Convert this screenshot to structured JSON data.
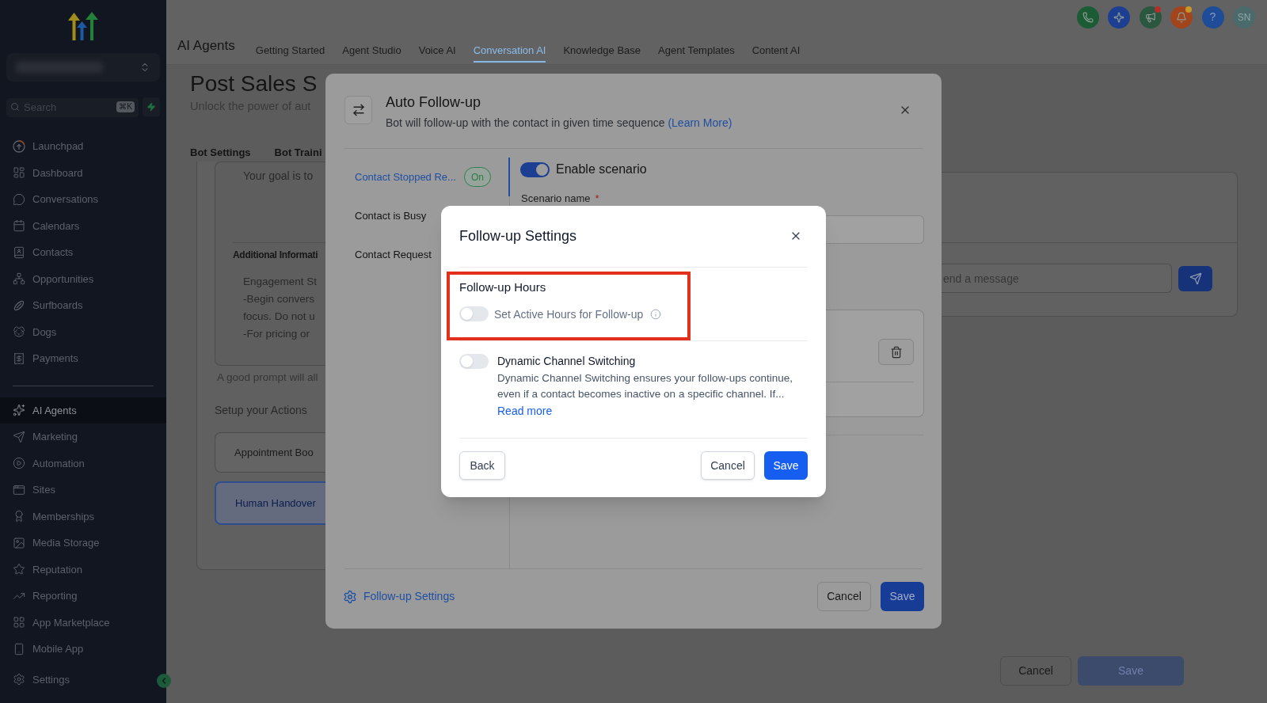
{
  "sidebar": {
    "search": {
      "placeholder": "Search",
      "shortcut": "⌘K"
    },
    "groups": [
      {
        "items": [
          {
            "label": "Launchpad",
            "selected": false
          },
          {
            "label": "Dashboard",
            "selected": false
          },
          {
            "label": "Conversations",
            "selected": false
          },
          {
            "label": "Calendars",
            "selected": false
          },
          {
            "label": "Contacts",
            "selected": false
          },
          {
            "label": "Opportunities",
            "selected": false
          },
          {
            "label": "Surfboards",
            "selected": false
          },
          {
            "label": "Dogs",
            "selected": false
          },
          {
            "label": "Payments",
            "selected": false
          }
        ]
      },
      {
        "items": [
          {
            "label": "AI Agents",
            "selected": true
          },
          {
            "label": "Marketing",
            "selected": false
          },
          {
            "label": "Automation",
            "selected": false
          },
          {
            "label": "Sites",
            "selected": false
          },
          {
            "label": "Memberships",
            "selected": false
          },
          {
            "label": "Media Storage",
            "selected": false
          },
          {
            "label": "Reputation",
            "selected": false
          },
          {
            "label": "Reporting",
            "selected": false
          },
          {
            "label": "App Marketplace",
            "selected": false
          },
          {
            "label": "Mobile App",
            "selected": false
          }
        ]
      }
    ],
    "settings": {
      "label": "Settings",
      "selected": false
    }
  },
  "header": {
    "title": "AI Agents",
    "tabs": [
      {
        "label": "Getting Started",
        "selected": false
      },
      {
        "label": "Agent Studio",
        "selected": false
      },
      {
        "label": "Voice AI",
        "selected": false
      },
      {
        "label": "Conversation AI",
        "selected": true
      },
      {
        "label": "Knowledge Base",
        "selected": false
      },
      {
        "label": "Agent Templates",
        "selected": false
      },
      {
        "label": "Content AI",
        "selected": false
      }
    ],
    "help_label": "?",
    "avatar_initials": "SN"
  },
  "page": {
    "title": "Post Sales S",
    "subtitle": "Unlock the power of aut",
    "tabs": [
      {
        "label": "Bot Settings"
      },
      {
        "label": "Bot Traini"
      }
    ],
    "prompt": {
      "intro": "Your goal is to",
      "section_title": "Additional Informati",
      "lines": [
        "Engagement St",
        "-Begin convers",
        "focus. Do not u",
        "-For pricing or"
      ]
    },
    "prompt_hint": "A good prompt will all",
    "actions_title": "Setup your Actions",
    "actions": [
      {
        "label": "Appointment Boo",
        "selected": false
      },
      {
        "label": "Human Handover",
        "selected": true
      }
    ],
    "chat": {
      "placeholder": "end a message"
    },
    "buttons": {
      "cancel": "Cancel",
      "save": {
        "label": "Save",
        "disabled": true
      }
    }
  },
  "auto_follow_up_dialog": {
    "title": "Auto Follow-up",
    "description": "Bot will follow-up with the contact in given time sequence",
    "learn_more": "(Learn More)",
    "scenarios": [
      {
        "label": "Contact Stopped Re...",
        "selected": true,
        "status": "On"
      },
      {
        "label": "Contact is Busy",
        "selected": false
      },
      {
        "label": "Contact Request",
        "selected": false
      }
    ],
    "enable_scenario": {
      "label": "Enable scenario",
      "on": true
    },
    "scenario_name": {
      "label": "Scenario name",
      "required_mark": "*"
    },
    "footer_link": "Follow-up Settings",
    "buttons": {
      "cancel": "Cancel",
      "save": "Save"
    }
  },
  "follow_up_settings_dialog": {
    "title": "Follow-up Settings",
    "follow_up_hours": {
      "title": "Follow-up Hours",
      "highlighted": true,
      "toggle": {
        "label": "Set Active Hours for Follow-up",
        "on": false
      }
    },
    "dynamic_channel_switching": {
      "title": "Dynamic Channel Switching",
      "on": false,
      "description": "Dynamic Channel Switching ensures your follow-ups continue, even if a contact becomes inactive on a specific channel. If...",
      "read_more": "Read more"
    },
    "buttons": {
      "back": "Back",
      "cancel": "Cancel",
      "save": "Save"
    }
  }
}
